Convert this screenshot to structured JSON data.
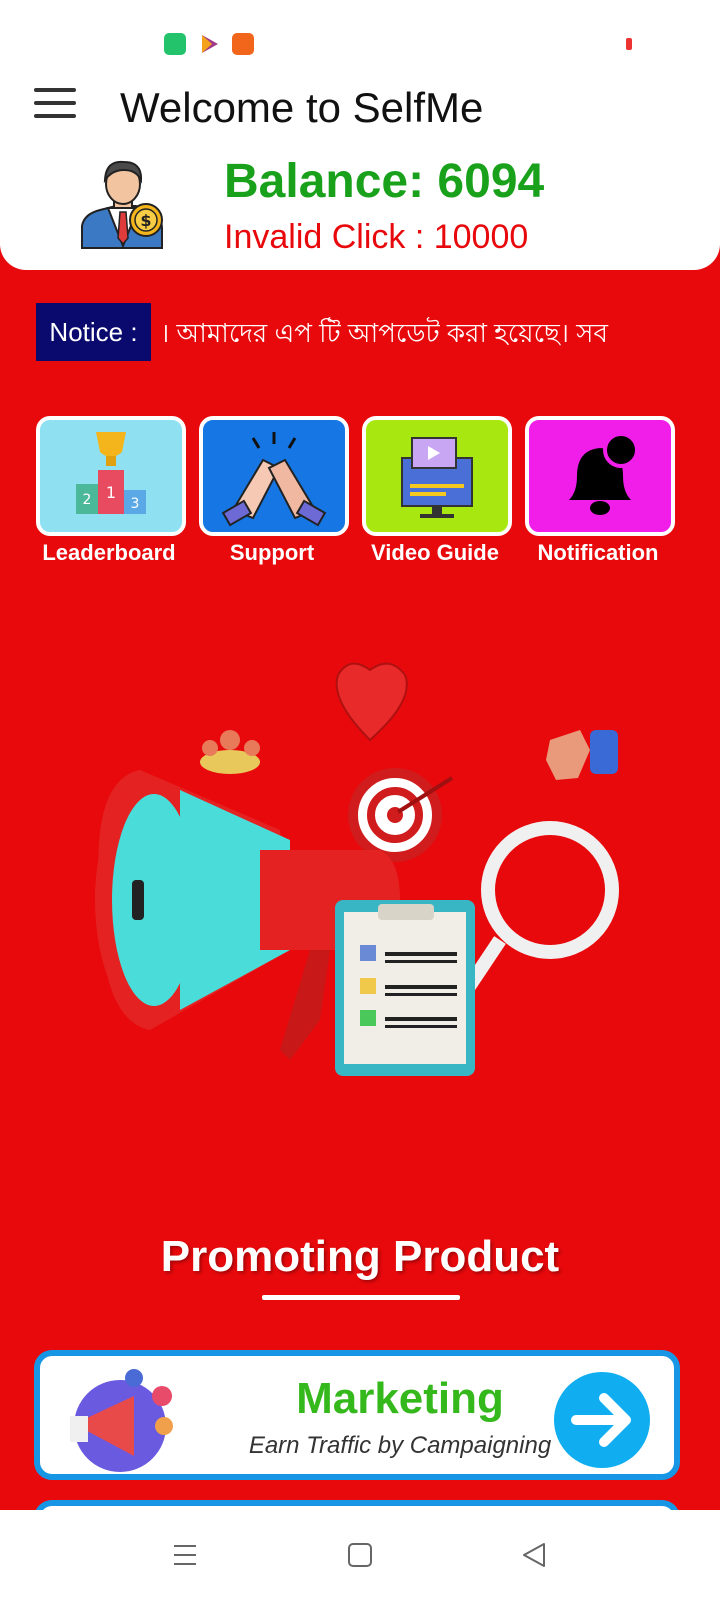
{
  "header": {
    "title": "Welcome to SelfMe",
    "balance": "Balance: 6094",
    "invalid_click": "Invalid Click : 10000"
  },
  "notice": {
    "label": "Notice :",
    "text": "। আমাদের এপ টি আপডেট করা হয়েছে। সব"
  },
  "quick_actions": [
    {
      "label": "Leaderboard",
      "icon": "leaderboard-podium-icon",
      "bg": "#8fe0f0"
    },
    {
      "label": "Support",
      "icon": "handshake-icon",
      "bg": "#1576e4"
    },
    {
      "label": "Video Guide",
      "icon": "video-monitor-icon",
      "bg": "#a8e810"
    },
    {
      "label": "Notification",
      "icon": "bell-icon",
      "bg": "#f01ee8"
    }
  ],
  "promo": {
    "title": "Promoting Product"
  },
  "marketing_card": {
    "title": "Marketing",
    "subtitle": "Earn Traffic by Campaigning"
  },
  "colors": {
    "background": "#e8090c",
    "balance": "#19a11b",
    "notice_bg": "#0a0a6e",
    "card_border": "#1796e6",
    "accent_green": "#35b81c"
  }
}
